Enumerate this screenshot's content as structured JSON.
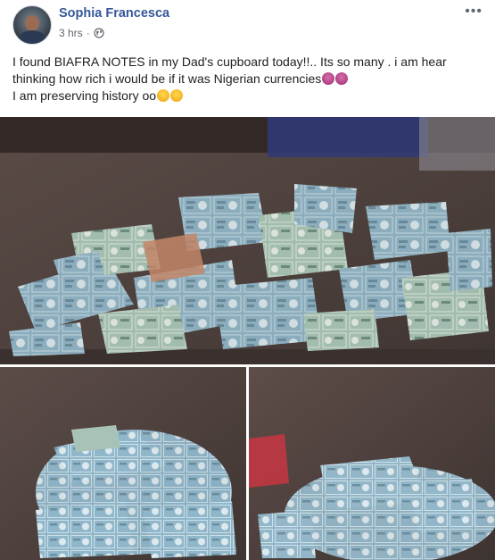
{
  "post": {
    "author": "Sophia Francesca",
    "timestamp": "3 hrs",
    "separator": "·",
    "more_label": "•••",
    "text_line1": "I found BIAFRA NOTES in my Dad's cupboard today!!.. Its so many . i am hear thinking how rich i would be if it was Nigerian currencies",
    "text_line2": "I am preserving history oo"
  },
  "icons": {
    "privacy": "globe-icon",
    "more": "more-options-icon"
  },
  "colors": {
    "author_link": "#365899",
    "meta_text": "#616770",
    "body_text": "#1c1e21",
    "note_blue": "#8fb7cf",
    "table_brown": "#4f413d"
  }
}
